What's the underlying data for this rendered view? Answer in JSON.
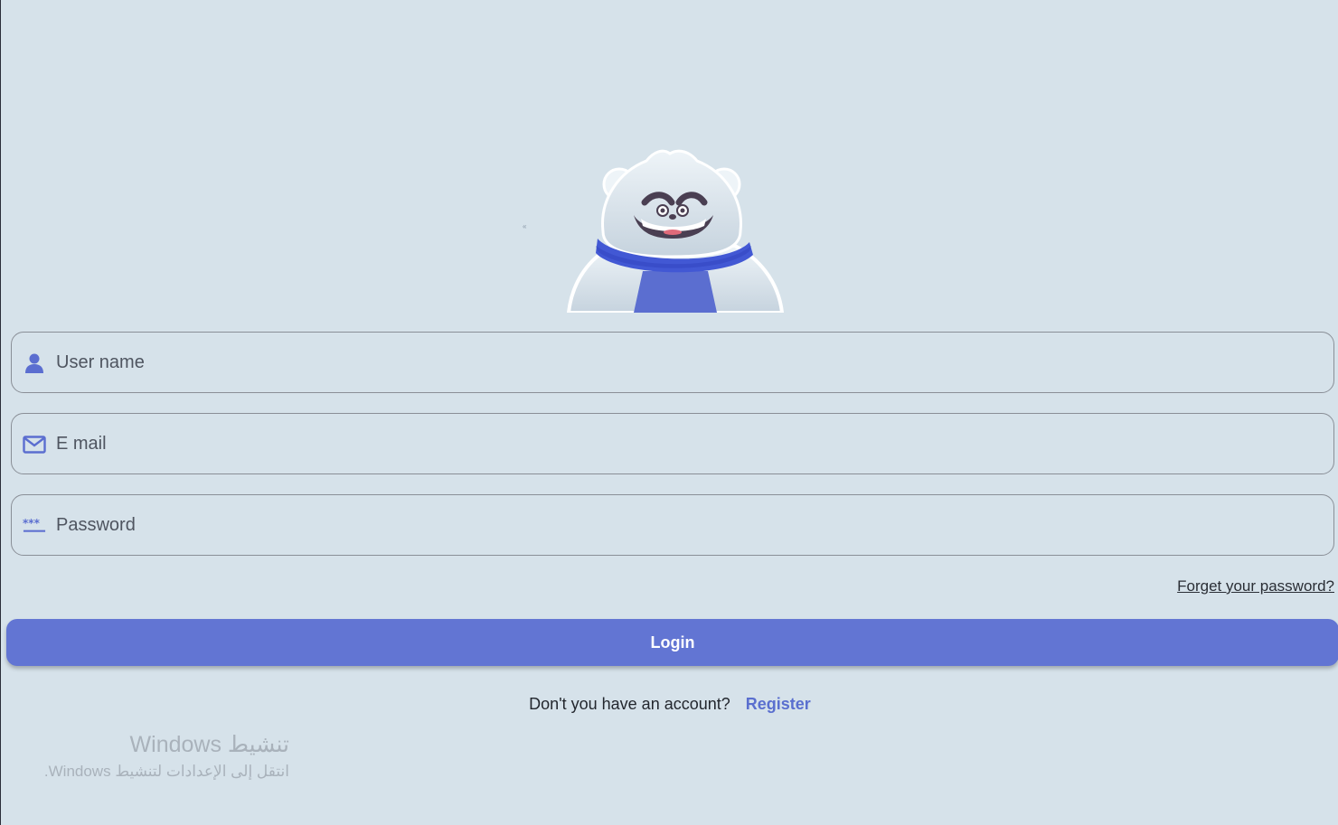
{
  "mascot": {
    "name": "yeti-mascot-icon",
    "colors": {
      "fur": "#e3ecf2",
      "scarf": "#4258d4",
      "body": "#5b6ed0",
      "eyebrow": "#4a3f52"
    }
  },
  "form": {
    "username": {
      "placeholder": "User name",
      "value": "",
      "icon": "person-icon"
    },
    "email": {
      "placeholder": "E mail",
      "value": "",
      "icon": "mail-icon"
    },
    "password": {
      "placeholder": "Password",
      "value": "",
      "icon": "password-dots-icon"
    }
  },
  "links": {
    "forget_password": "Forget your password?"
  },
  "login_button": {
    "label": "Login"
  },
  "register": {
    "question": "Don't you have an account?",
    "link_label": "Register"
  },
  "watermark": {
    "title": "تنشيط Windows",
    "subtitle": "انتقل إلى الإعدادات لتنشيط Windows."
  },
  "colors": {
    "background": "#d6e2ea",
    "accent": "#6275d3",
    "icon": "#5b6ed0"
  }
}
